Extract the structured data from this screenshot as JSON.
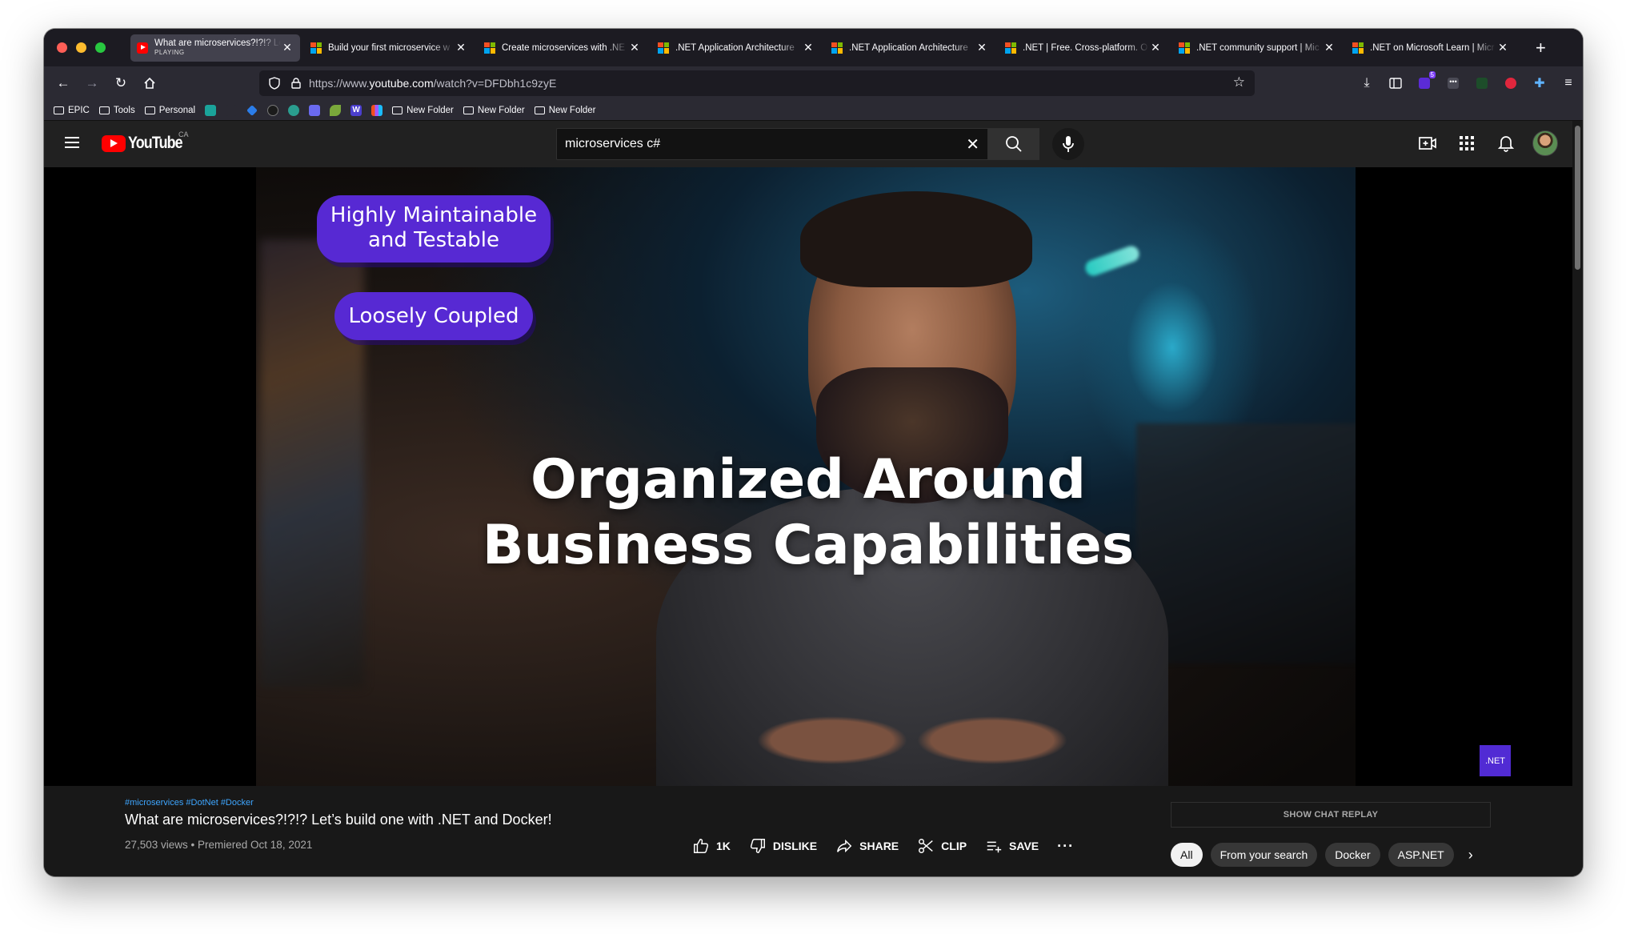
{
  "browser": {
    "tabs": [
      {
        "title": "What are microservices?!?!? Le",
        "sub": "PLAYING",
        "icon": "youtube",
        "active": true
      },
      {
        "title": "Build your first microservice w",
        "icon": "microsoft"
      },
      {
        "title": "Create microservices with .NE",
        "icon": "microsoft"
      },
      {
        "title": ".NET Application Architecture",
        "icon": "microsoft"
      },
      {
        "title": ".NET Application Architecture",
        "icon": "microsoft"
      },
      {
        "title": ".NET | Free. Cross-platform. O",
        "icon": "microsoft"
      },
      {
        "title": ".NET community support | Mic",
        "icon": "microsoft"
      },
      {
        "title": ".NET on Microsoft Learn | Micr",
        "icon": "microsoft"
      }
    ],
    "url_prefix": "https://www.",
    "url_domain": "youtube.com",
    "url_rest": "/watch?v=DFDbh1c9zyE",
    "ext_badge_count": "5",
    "bookmarks": {
      "epic": "EPIC",
      "tools": "Tools",
      "personal": "Personal",
      "folder1": "New Folder",
      "folder2": "New Folder",
      "folder3": "New Folder"
    }
  },
  "youtube": {
    "logo_text": "YouTube",
    "region": "CA",
    "search_value": "microservices c#",
    "video": {
      "overlay_pill1": "Highly Maintainable and Testable",
      "overlay_pill2": "Loosely Coupled",
      "overlay_big_line1": "Organized Around",
      "overlay_big_line2": "Business Capabilities",
      "watermark": ".NET"
    },
    "info": {
      "hashtags": "#microservices #DotNet #Docker",
      "title": "What are microservices?!?!? Let’s build one with .NET and Docker!",
      "meta": "27,503 views • Premiered Oct 18, 2021",
      "like_count": "1K",
      "dislike_label": "DISLIKE",
      "share_label": "SHARE",
      "clip_label": "CLIP",
      "save_label": "SAVE",
      "chat_replay": "SHOW CHAT REPLAY",
      "chips": [
        "All",
        "From your search",
        "Docker",
        "ASP.NET"
      ]
    }
  },
  "colors": {
    "yt_red": "#ff0000",
    "net_purple": "#512bd4",
    "pill_purple": "#5729d3",
    "link_blue": "#3ea6ff"
  }
}
